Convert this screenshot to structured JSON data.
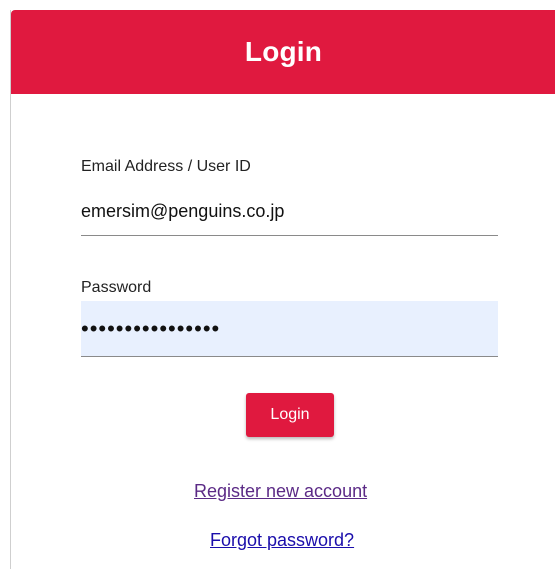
{
  "colors": {
    "accent": "#e0193f",
    "input_fill": "#e8f0fe",
    "link_visited": "#5b2a86",
    "link": "#1a0dab"
  },
  "header": {
    "title": "Login"
  },
  "form": {
    "email_label": "Email Address / User ID",
    "email_value": "emersim@penguins.co.jp",
    "password_label": "Password",
    "password_value": "••••••••••••••••",
    "submit_label": "Login"
  },
  "links": {
    "register": "Register new account",
    "forgot": "Forgot password?"
  }
}
